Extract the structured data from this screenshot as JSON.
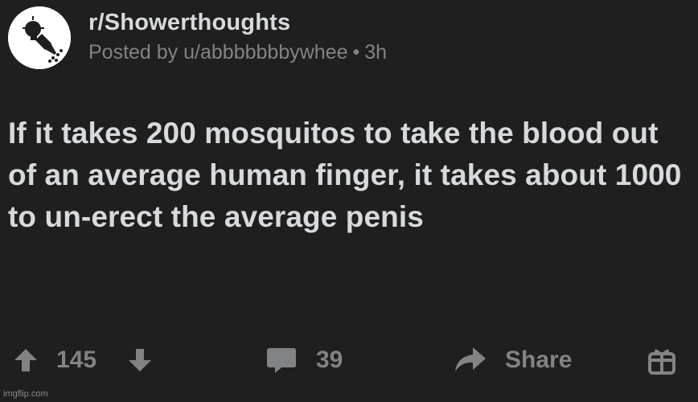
{
  "post": {
    "subreddit": "r/Showerthoughts",
    "posted_by_prefix": "Posted by",
    "username": "u/abbbbbbbywhee",
    "separator": "•",
    "age": "3h",
    "title": "If it takes 200 mosquitos to take the blood out of an average human finger, it takes about 1000 to un-erect the average penis",
    "icons": {
      "avatar": "shower-head-lightbulb-icon",
      "upvote": "arrow-up-icon",
      "downvote": "arrow-down-icon",
      "comments": "comment-bubble-icon",
      "share": "share-arrow-icon",
      "award": "gift-icon"
    }
  },
  "actions": {
    "score": "145",
    "comments": "39",
    "share_label": "Share"
  },
  "watermark": "imgflip.com",
  "colors": {
    "background": "#1f1f20",
    "text": "#d7dadc",
    "muted": "#818384"
  }
}
